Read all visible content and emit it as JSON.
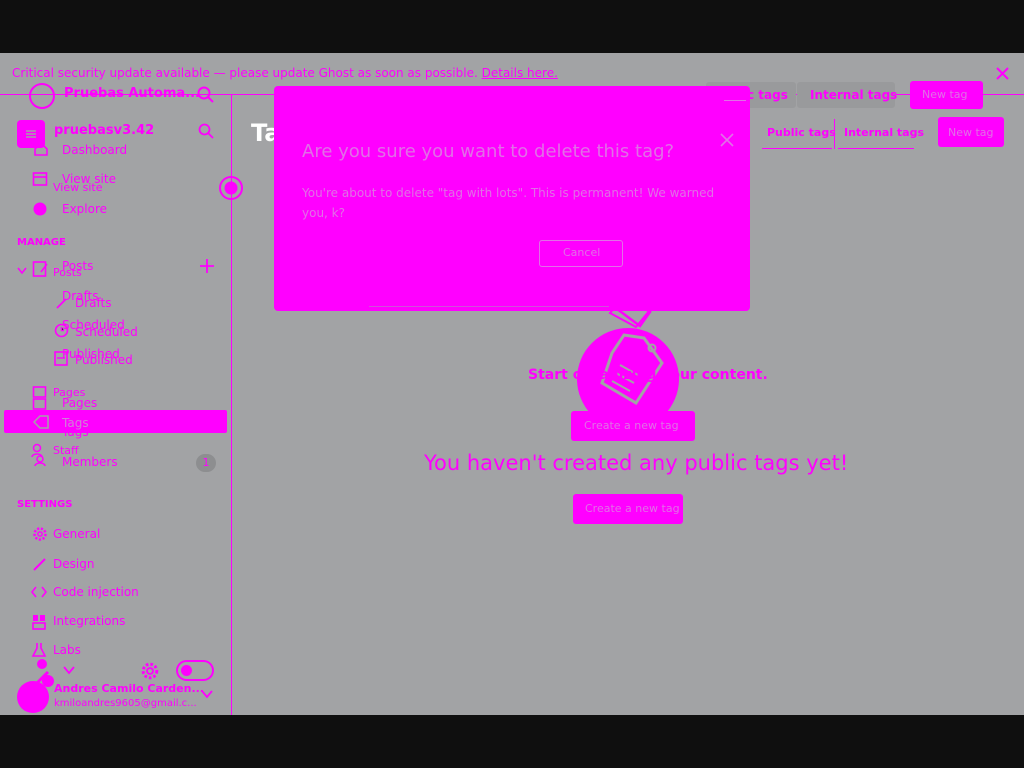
{
  "banner": {
    "message": "Critical security update available — please update Ghost as soon as possible.",
    "link": "Details here."
  },
  "sidebar_back": {
    "site_name": "Pruebas Automa...",
    "dashboard": "Dashboard",
    "view_site": "View site",
    "explore": "Explore",
    "drafts": "Drafts",
    "scheduled": "Scheduled",
    "published": "Published",
    "pages": "Pages",
    "tags": "Tags",
    "members": "Members",
    "members_count": "1"
  },
  "sidebar_front": {
    "site_name": "pruebasv3.42",
    "view_site": "View site",
    "manage_heading": "MANAGE",
    "posts": "Posts",
    "drafts": "Drafts",
    "scheduled": "Scheduled",
    "published": "Published",
    "pages": "Pages",
    "tags": "Tags",
    "staff": "Staff",
    "settings_heading": "SETTINGS",
    "general": "General",
    "design": "Design",
    "code_injection": "Code injection",
    "integrations": "Integrations",
    "labs": "Labs",
    "user_name": "Andres Camilo Carden...",
    "user_email": "kmiloandres9605@gmail.c..."
  },
  "header": {
    "page_title": "Tags",
    "public_tags_tab": "Public tags",
    "internal_tags_tab": "Internal tags",
    "new_tag_button": "New tag",
    "back_tab_partial": "c tags",
    "back_internal_tab": "Internal tags",
    "back_new_tag": "New tag"
  },
  "empty_state": {
    "heading": "Start organizing your content.",
    "create_button": "Create a new tag",
    "message": "You haven't created any public tags yet!",
    "create_button_2": "Create a new tag"
  },
  "modal": {
    "title": "Are you sure you want to delete this tag?",
    "body": "You're about to delete \"tag with lots\". This is permanent! We warned you, k?",
    "cancel": "Cancel"
  },
  "colors": {
    "accent": "#ff00ff",
    "backdrop": "#a2a3a5",
    "frame": "#0f0f0f"
  }
}
